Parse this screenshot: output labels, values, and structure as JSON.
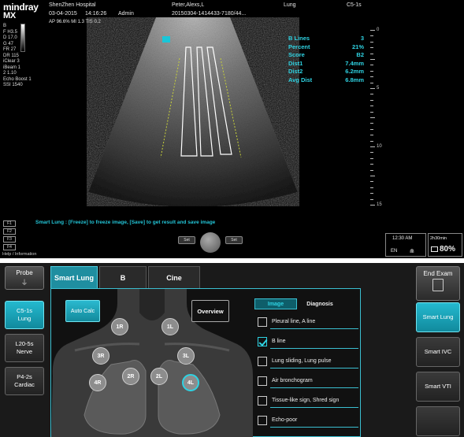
{
  "header": {
    "brand": "mindray",
    "model": "MX",
    "hospital": "ShenZhen Hospital",
    "date": "03-04-2015",
    "time": "14:16:26",
    "operator": "Admin",
    "patient": "Peter,Alexs,L",
    "exam_id": "20150304-1414433-7180/44...",
    "exam_type": "Lung",
    "probe": "C5-1s",
    "acoustic": "AP 96.6%   MI 1.3   TIS 0.2"
  },
  "image_params": [
    "B",
    "F H3.5",
    "D 17.0",
    "G 47",
    "FR 27",
    "DR 115",
    "iClear 3",
    "iBeam 1",
    "2 1.10",
    "Echo Boost 1",
    "SSI 1540"
  ],
  "measurements": [
    {
      "label": "B Lines",
      "value": "3"
    },
    {
      "label": "Percent",
      "value": "21%"
    },
    {
      "label": "Score",
      "value": "B2"
    },
    {
      "label": "Dist1",
      "value": "7.4mm"
    },
    {
      "label": "Dist2",
      "value": "6.2mm"
    },
    {
      "label": "Avg Dist",
      "value": "6.8mm"
    }
  ],
  "depth_scale": [
    "0",
    "5",
    "10",
    "15"
  ],
  "status_message": "Smart Lung : [Freeze] to freeze image, [Save] to get result and save image",
  "function_keys": [
    "F1",
    "F2",
    "F3",
    "F4"
  ],
  "help_label": "Help / Information",
  "trackball": {
    "left": "Set",
    "right": "Set"
  },
  "clock": {
    "time": "12:30 AM",
    "lang": "EN"
  },
  "battery": {
    "remaining": "2h30min",
    "percent": "80%"
  },
  "probe_panel": {
    "title": "Probe",
    "probes": [
      {
        "line1": "C5-1s",
        "line2": "Lung",
        "active": true
      },
      {
        "line1": "L20-5s",
        "line2": "Nerve",
        "active": false
      },
      {
        "line1": "P4-2s",
        "line2": "Cardiac",
        "active": false
      }
    ]
  },
  "tabs": [
    {
      "label": "Smart Lung",
      "active": true
    },
    {
      "label": "B",
      "active": false
    },
    {
      "label": "Cine",
      "active": false
    }
  ],
  "smart_lung": {
    "auto_calc": "Auto Calc",
    "overview": "Overview",
    "zones": [
      {
        "label": "1R",
        "active": false
      },
      {
        "label": "1L",
        "active": false
      },
      {
        "label": "3R",
        "active": false
      },
      {
        "label": "3L",
        "active": false
      },
      {
        "label": "2R",
        "active": false
      },
      {
        "label": "2L",
        "active": false
      },
      {
        "label": "4R",
        "active": false
      },
      {
        "label": "4L",
        "active": true
      }
    ],
    "subtabs": {
      "image": "Image",
      "diagnosis": "Diagnosis"
    },
    "signs": [
      {
        "label": "Pleural line, A line",
        "checked": false
      },
      {
        "label": "B line",
        "checked": true
      },
      {
        "label": "Lung sliding, Lung pulse",
        "checked": false
      },
      {
        "label": "Air bronchogram",
        "checked": false
      },
      {
        "label": "Tissue-like sign, Shred sign",
        "checked": false
      },
      {
        "label": "Echo-poor",
        "checked": false
      }
    ]
  },
  "right_panel": {
    "end_exam": "End Exam",
    "modes": [
      {
        "label": "Smart Lung",
        "active": true
      },
      {
        "label": "Smart IVC",
        "active": false
      },
      {
        "label": "Smart VTI",
        "active": false
      }
    ]
  },
  "colors": {
    "accent": "#19c6d8",
    "active_button": "#1f9fb3"
  }
}
